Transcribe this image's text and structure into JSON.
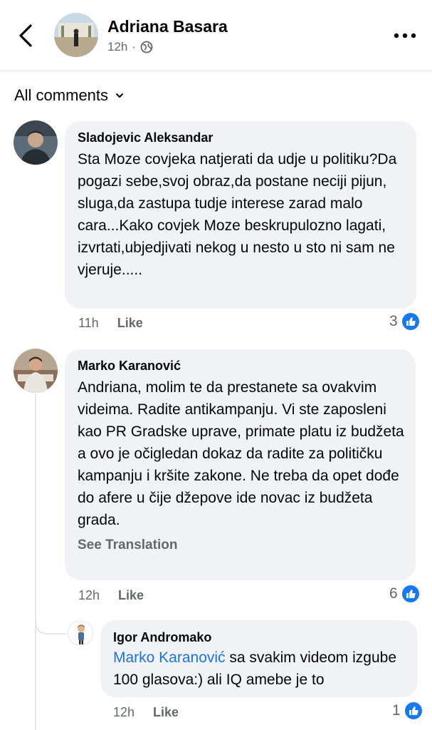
{
  "header": {
    "author": "Adriana Basara",
    "time": "12h",
    "separator": "·"
  },
  "filter": {
    "label": "All comments"
  },
  "comments": [
    {
      "author": "Sladojevic Aleksandar",
      "text": "Sta Moze covjeka natjerati da udje u politiku?Da pogazi sebe,svoj obraz,da postane neciji pijun, sluga,da zastupa tudje interese zarad malo cara...Kako covjek Moze beskrupulozno lagati, izvrtati,ubjedjivati nekog u nesto u sto ni sam ne vjeruje.....",
      "time": "11h",
      "like_label": "Like",
      "reactions": "3"
    },
    {
      "author": "Marko Karanović",
      "text": "Andriana, molim te da prestanete sa ovakvim videima. Radite antikampanju. Vi ste zaposleni kao PR Gradske uprave, primate platu iz budžeta a ovo je očigledan dokaz da radite za političku kampanju i kršite zakone. Ne treba da opet dođe do afere u čije džepove ide novac iz budžeta grada.",
      "see_translation": "See Translation",
      "time": "12h",
      "like_label": "Like",
      "reactions": "6"
    },
    {
      "author": "Igor Andromako",
      "mention": "Marko Karanović",
      "text": " sa svakim videom izgube 100 glasova:) ali IQ amebe je to",
      "time": "12h",
      "like_label": "Like",
      "reactions": "1"
    }
  ],
  "colors": {
    "accent": "#1877f2",
    "mention": "#1b74e4",
    "bubble": "#f0f2f5",
    "secondary_text": "#65676b"
  },
  "icons": [
    "back-arrow-icon",
    "globe-icon",
    "more-options-icon",
    "chevron-down-icon",
    "like-thumb-icon"
  ]
}
